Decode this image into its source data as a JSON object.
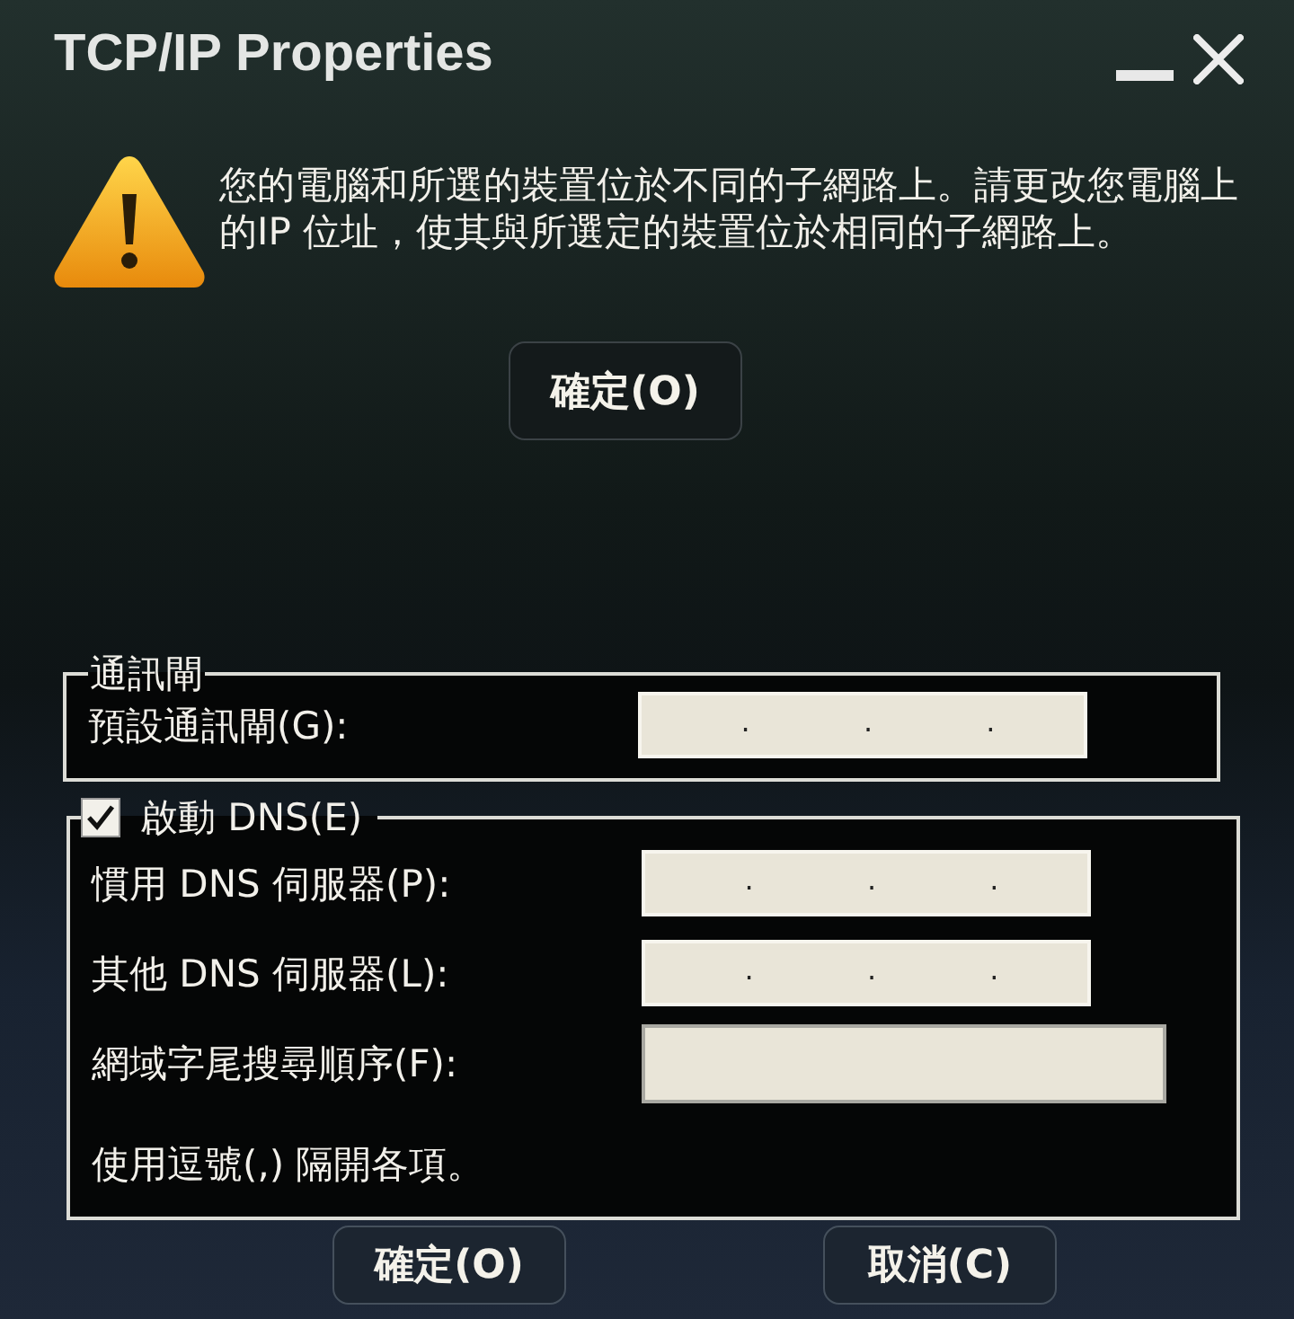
{
  "window": {
    "title": "TCP/IP Properties"
  },
  "alert": {
    "message": "您的電腦和所選的裝置位於不同的子網路上。請更改您電腦上的IP 位址，使其與所選定的裝置位於相同的子網路上。",
    "button": "確定(O)"
  },
  "gateway_group": {
    "legend": "通訊閘",
    "fields": [
      {
        "kind": "ip",
        "label": "預設通訊閘(G):",
        "value": ". . ."
      }
    ]
  },
  "dns_group": {
    "checkbox": {
      "label": "啟動 DNS(E)",
      "checked": true
    },
    "fields": [
      {
        "kind": "ip",
        "label": "慣用 DNS 伺服器(P):",
        "value": ". . ."
      },
      {
        "kind": "ip",
        "label": "其他 DNS 伺服器(L):",
        "value": ". . ."
      },
      {
        "kind": "text",
        "label": "網域字尾搜尋順序(F):"
      }
    ],
    "note": "使用逗號(,) 隔開各項。"
  },
  "buttons": [
    {
      "label": "確定(O)"
    },
    {
      "label": "取消(C)"
    }
  ]
}
